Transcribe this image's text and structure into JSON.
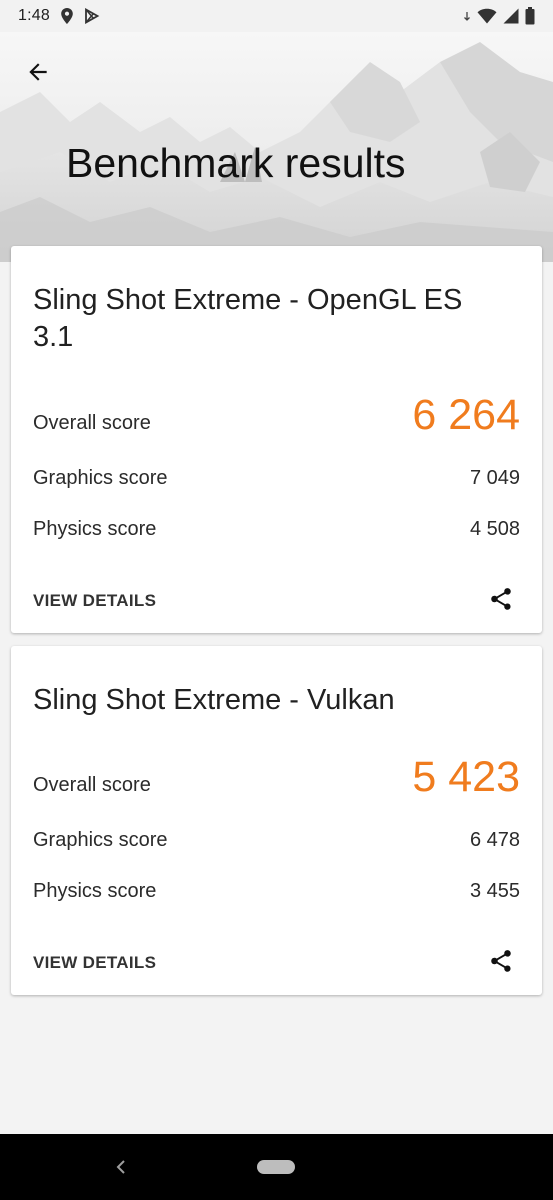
{
  "status_bar": {
    "time": "1:48"
  },
  "header": {
    "title": "Benchmark results"
  },
  "results": [
    {
      "title": "Sling Shot Extreme - OpenGL ES 3.1",
      "overall_label": "Overall score",
      "overall_value": "6 264",
      "graphics_label": "Graphics score",
      "graphics_value": "7 049",
      "physics_label": "Physics score",
      "physics_value": "4 508",
      "view_details_label": "VIEW DETAILS"
    },
    {
      "title": "Sling Shot Extreme - Vulkan",
      "overall_label": "Overall score",
      "overall_value": "5 423",
      "graphics_label": "Graphics score",
      "graphics_value": "6 478",
      "physics_label": "Physics score",
      "physics_value": "3 455",
      "view_details_label": "VIEW DETAILS"
    }
  ],
  "colors": {
    "accent_score": "#f07c1e",
    "card_background": "#ffffff",
    "page_background": "#f3f3f3",
    "nav_bar": "#000000"
  },
  "icons": {
    "back": "arrow-left-icon",
    "share": "share-icon",
    "location": "location-icon",
    "play_store": "play-store-icon",
    "wifi": "wifi-icon",
    "cellular": "cellular-signal-icon",
    "battery": "battery-icon"
  }
}
